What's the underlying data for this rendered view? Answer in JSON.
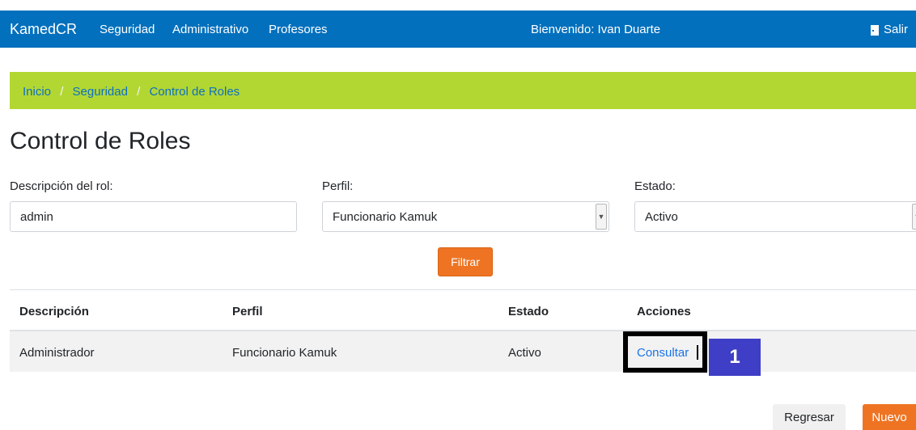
{
  "navbar": {
    "brand": "KamedCR",
    "items": [
      "Seguridad",
      "Administrativo",
      "Profesores"
    ],
    "welcome": "Bienvenido: Ivan Duarte",
    "logout": "Salir"
  },
  "breadcrumb": {
    "items": [
      "Inicio",
      "Seguridad",
      "Control de Roles"
    ],
    "separator": "/"
  },
  "page": {
    "title": "Control de Roles"
  },
  "filters": {
    "description_label": "Descripción del rol:",
    "description_value": "admin",
    "profile_label": "Perfil:",
    "profile_value": "Funcionario Kamuk",
    "status_label": "Estado:",
    "status_value": "Activo",
    "filter_button": "Filtrar"
  },
  "table": {
    "headers": [
      "Descripción",
      "Perfil",
      "Estado",
      "Acciones"
    ],
    "rows": [
      {
        "description": "Administrador",
        "profile": "Funcionario Kamuk",
        "status": "Activo",
        "action": "Consultar"
      }
    ]
  },
  "annotation": {
    "step": "1"
  },
  "footer": {
    "back_button": "Regresar",
    "new_button": "Nuevo"
  },
  "colors": {
    "navbar": "#0270bd",
    "breadcrumb": "#b2d732",
    "accent_button": "#ee7423",
    "step_badge": "#3f3ec6"
  }
}
